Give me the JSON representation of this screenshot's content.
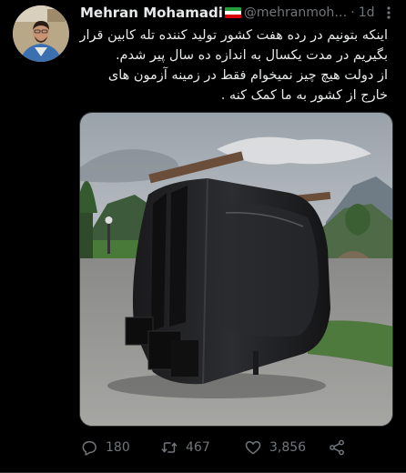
{
  "author": {
    "name": "Mehran Mohamadi",
    "handle": "@mehranmoh…",
    "separator": "·",
    "time": "1d",
    "flag_colors": [
      "#239f40",
      "#ffffff",
      "#da0000"
    ]
  },
  "tweet": {
    "lines": [
      "اینکه بتونیم در رده هفت کشور تولید کننده  تله کابین قرار",
      "بگیریم در مدت یکسال به اندازه ده سال پیر شدم.",
      "از دولت هیچ چیز نمیخوام فقط در زمینه آزمون های",
      "خارج از کشور به ما کمک کنه ."
    ]
  },
  "actions": {
    "replies": "180",
    "retweets": "467",
    "likes": "3,856"
  },
  "icons": {
    "more": "more-dots-icon",
    "reply": "reply-bubble-icon",
    "retweet": "retweet-icon",
    "like": "heart-icon",
    "share": "share-icon"
  },
  "colors": {
    "background": "#000000",
    "text": "#e7e9ea",
    "muted": "#71767b"
  }
}
